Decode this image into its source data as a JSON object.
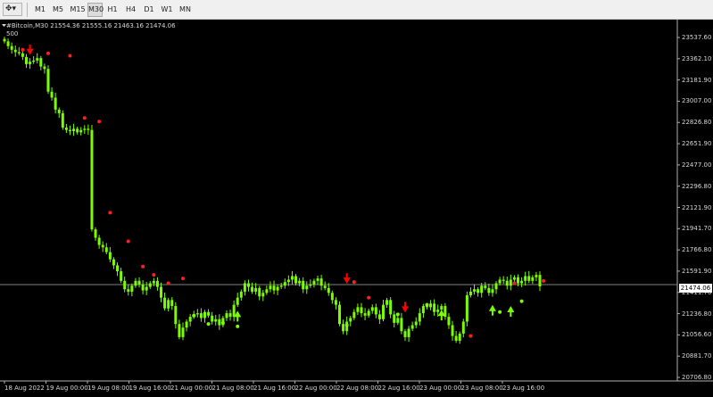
{
  "toolbar": {
    "dropdown_icon": "crosshair-dropdown-icon",
    "timeframes": [
      {
        "label": "M1",
        "active": false
      },
      {
        "label": "M5",
        "active": false
      },
      {
        "label": "M15",
        "active": false
      },
      {
        "label": "M30",
        "active": true
      },
      {
        "label": "H1",
        "active": false
      },
      {
        "label": "H4",
        "active": false
      },
      {
        "label": "D1",
        "active": false
      },
      {
        "label": "W1",
        "active": false
      },
      {
        "label": "MN",
        "active": false
      }
    ]
  },
  "chart": {
    "header": "#Bitcoin,M30  21554.36 21555.16 21463.16 21474.06",
    "sub_label": "500",
    "bid_label": "21474.06",
    "colors": {
      "background": "#000000",
      "candles": "#7CFC00",
      "arrow_signal": "#ff0000",
      "dot_signal_up": "#ff2020",
      "dot_signal_down": "#7CFC00",
      "grid": "#808080"
    },
    "price_ticks": [
      "23537.60",
      "23362.10",
      "23181.90",
      "23007.00",
      "22826.80",
      "22651.90",
      "22477.00",
      "22296.80",
      "22121.90",
      "21941.70",
      "21766.80",
      "21591.90",
      "21411.70",
      "21236.80",
      "21056.60",
      "20881.70",
      "20706.80"
    ],
    "time_ticks": [
      "18 Aug 2022",
      "19 Aug 00:00",
      "19 Aug 08:00",
      "19 Aug 16:00",
      "21 Aug 00:00",
      "21 Aug 08:00",
      "21 Aug 16:00",
      "22 Aug 00:00",
      "22 Aug 08:00",
      "22 Aug 16:00",
      "23 Aug 00:00",
      "23 Aug 08:00",
      "23 Aug 16:00"
    ],
    "chart_data": {
      "type": "candlestick",
      "symbol": "#Bitcoin",
      "timeframe": "M30",
      "ylim": [
        20706.8,
        23537.6
      ],
      "closes": [
        23520,
        23480,
        23450,
        23430,
        23420,
        23390,
        23330,
        23350,
        23360,
        23380,
        23310,
        23290,
        23100,
        23050,
        22950,
        22920,
        22800,
        22780,
        22770,
        22790,
        22760,
        22780,
        22790,
        22780,
        21950,
        21880,
        21820,
        21800,
        21760,
        21700,
        21650,
        21600,
        21520,
        21450,
        21430,
        21480,
        21520,
        21490,
        21440,
        21470,
        21500,
        21520,
        21470,
        21380,
        21290,
        21360,
        21310,
        21160,
        21050,
        21130,
        21180,
        21220,
        21240,
        21250,
        21210,
        21260,
        21230,
        21180,
        21200,
        21150,
        21210,
        21250,
        21220,
        21320,
        21380,
        21430,
        21500,
        21470,
        21430,
        21460,
        21390,
        21420,
        21450,
        21480,
        21440,
        21470,
        21480,
        21510,
        21530,
        21560,
        21500,
        21520,
        21450,
        21480,
        21490,
        21520,
        21540,
        21480,
        21460,
        21420,
        21360,
        21320,
        21160,
        21100,
        21180,
        21210,
        21260,
        21300,
        21250,
        21230,
        21270,
        21300,
        21240,
        21200,
        21320,
        21360,
        21240,
        21170,
        21210,
        21100,
        21050,
        21120,
        21150,
        21180,
        21250,
        21310,
        21300,
        21330,
        21260,
        21280,
        21310,
        21220,
        21150,
        21060,
        21020,
        21080,
        21180,
        21400,
        21430,
        21450,
        21420,
        21480,
        21460,
        21420,
        21450,
        21500,
        21530,
        21520,
        21480,
        21530,
        21550,
        21500,
        21520,
        21560,
        21520,
        21550,
        21570,
        21474
      ]
    },
    "signals": {
      "arrows_down_at": [
        23420,
        21510,
        21270
      ],
      "arrows_up_at": [
        21240,
        21250,
        21290,
        21280
      ],
      "dots_up": [
        23450,
        23420,
        23400,
        22880,
        22850,
        22090,
        21850,
        21640,
        21570,
        21500,
        21540,
        21510,
        21380,
        21060,
        21500,
        21520
      ],
      "dots_down": [
        21230,
        21160,
        21170,
        21140,
        21150,
        21240,
        21320,
        21260,
        21350
      ]
    }
  }
}
